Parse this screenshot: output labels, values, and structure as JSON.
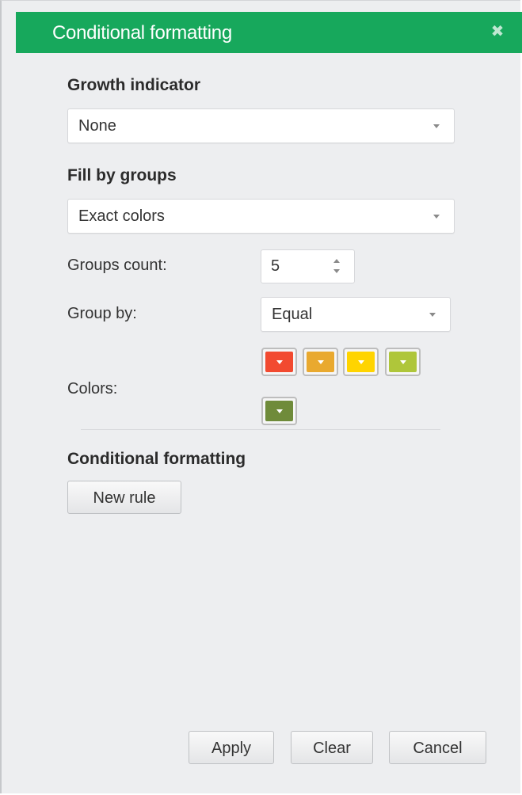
{
  "dialog": {
    "title": "Conditional formatting",
    "close_icon": "close-icon"
  },
  "growth": {
    "heading": "Growth indicator",
    "selected": "None"
  },
  "fill": {
    "heading": "Fill by groups",
    "selected": "Exact colors",
    "groups_count_label": "Groups count:",
    "groups_count_value": "5",
    "group_by_label": "Group by:",
    "group_by_selected": "Equal",
    "colors_label": "Colors:",
    "colors": [
      "#f24a30",
      "#e9a92f",
      "#ffd400",
      "#afc63a",
      "#6f8b3a"
    ]
  },
  "conditional": {
    "heading": "Conditional formatting",
    "new_rule_label": "New rule"
  },
  "footer": {
    "apply_label": "Apply",
    "clear_label": "Clear",
    "cancel_label": "Cancel"
  }
}
